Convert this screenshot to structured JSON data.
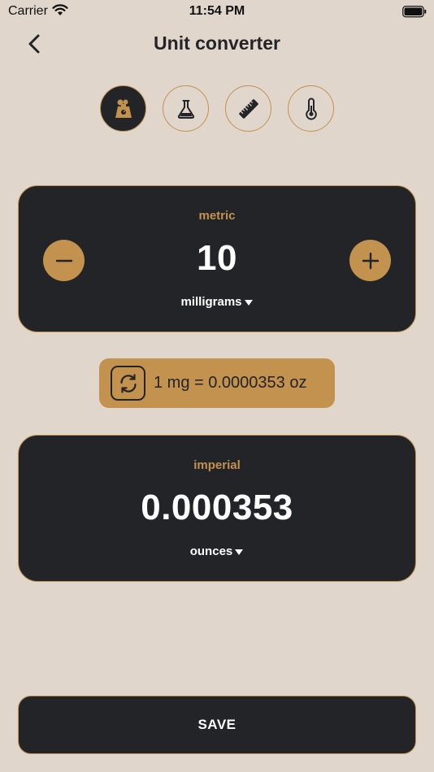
{
  "status_bar": {
    "carrier": "Carrier",
    "time": "11:54 PM"
  },
  "header": {
    "title": "Unit converter"
  },
  "categories": [
    {
      "icon": "weight-scale-icon",
      "active": true
    },
    {
      "icon": "flask-icon",
      "active": false
    },
    {
      "icon": "ruler-icon",
      "active": false
    },
    {
      "icon": "thermometer-icon",
      "active": false
    }
  ],
  "metric": {
    "label": "metric",
    "value": "10",
    "unit": "milligrams"
  },
  "rate": {
    "text": "1 mg = 0.0000353 oz"
  },
  "imperial": {
    "label": "imperial",
    "value": "0.000353",
    "unit": "ounces"
  },
  "save": {
    "label": "SAVE"
  },
  "colors": {
    "background": "#e1d6cb",
    "card": "#232427",
    "accent": "#c2924e",
    "text_light": "#ffffff"
  }
}
